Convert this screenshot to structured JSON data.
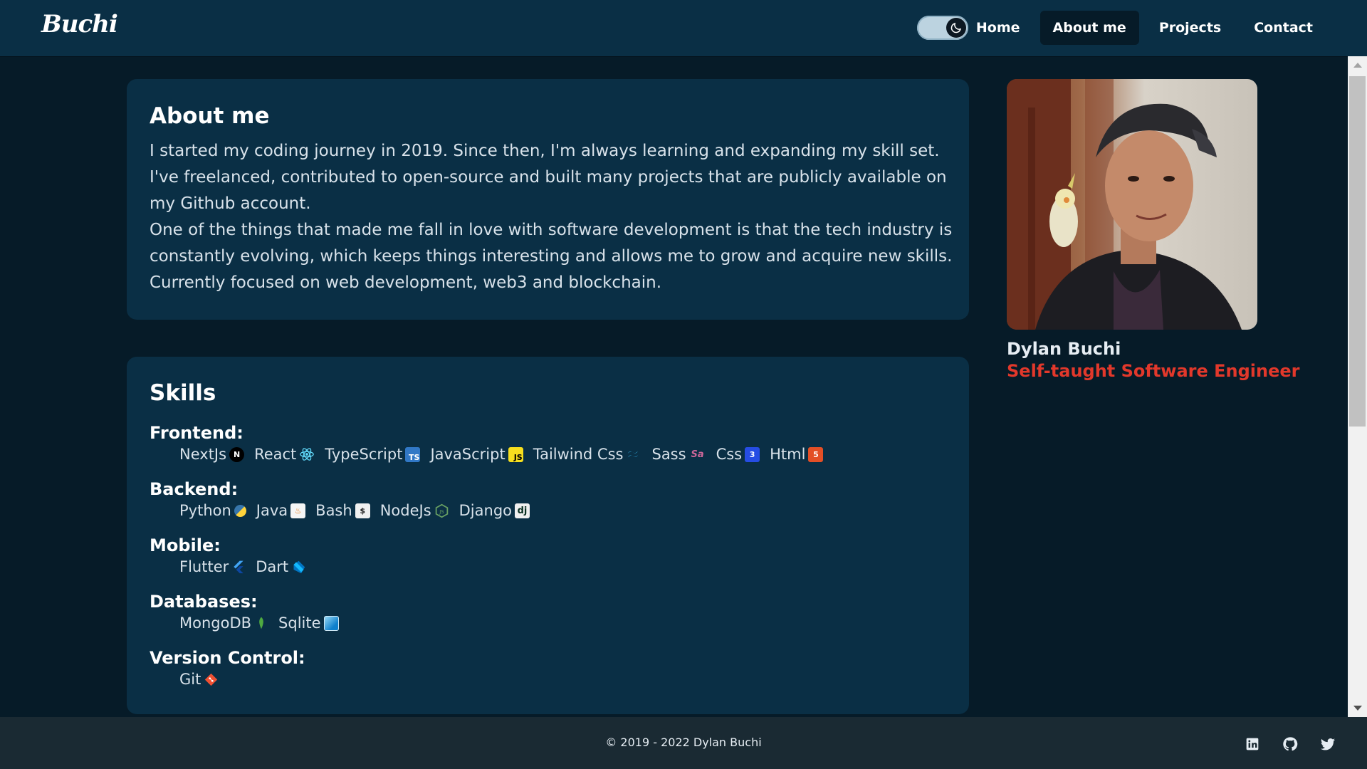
{
  "navbar": {
    "logo": "Buchi",
    "theme_toggle_icon": "moon-icon",
    "links": [
      {
        "label": "Home",
        "active": false
      },
      {
        "label": "About me",
        "active": true
      },
      {
        "label": "Projects",
        "active": false
      },
      {
        "label": "Contact",
        "active": false
      }
    ]
  },
  "about": {
    "title": "About me",
    "paragraph1": "I started my coding journey in 2019. Since then, I'm always learning and expanding my skill set. I've freelanced, contributed to open-source and built many projects that are publicly available on my Github account.",
    "paragraph2": "One of the things that made me fall in love with software development is that the tech industry is constantly evolving, which keeps things interesting and allows me to grow and acquire new skills. Currently focused on web development, web3 and blockchain."
  },
  "skills": {
    "title": "Skills",
    "groups": [
      {
        "category": "Frontend:",
        "items": [
          {
            "name": "NextJs",
            "icon": "nextjs-icon"
          },
          {
            "name": "React",
            "icon": "react-icon"
          },
          {
            "name": "TypeScript",
            "icon": "typescript-icon"
          },
          {
            "name": "JavaScript",
            "icon": "javascript-icon"
          },
          {
            "name": "Tailwind Css",
            "icon": "tailwind-icon"
          },
          {
            "name": "Sass",
            "icon": "sass-icon"
          },
          {
            "name": "Css",
            "icon": "css-icon"
          },
          {
            "name": "Html",
            "icon": "html-icon"
          }
        ]
      },
      {
        "category": "Backend:",
        "items": [
          {
            "name": "Python",
            "icon": "python-icon"
          },
          {
            "name": "Java",
            "icon": "java-icon"
          },
          {
            "name": "Bash",
            "icon": "bash-icon"
          },
          {
            "name": "NodeJs",
            "icon": "nodejs-icon"
          },
          {
            "name": "Django",
            "icon": "django-icon"
          }
        ]
      },
      {
        "category": "Mobile:",
        "items": [
          {
            "name": "Flutter",
            "icon": "flutter-icon"
          },
          {
            "name": "Dart",
            "icon": "dart-icon"
          }
        ]
      },
      {
        "category": "Databases:",
        "items": [
          {
            "name": "MongoDB",
            "icon": "mongodb-icon"
          },
          {
            "name": "Sqlite",
            "icon": "sqlite-icon"
          }
        ]
      },
      {
        "category": "Version Control:",
        "items": [
          {
            "name": "Git",
            "icon": "git-icon"
          }
        ]
      }
    ]
  },
  "profile": {
    "name": "Dylan Buchi",
    "title": "Self-taught Software Engineer",
    "photo": "profile-photo"
  },
  "footer": {
    "copyright": "© 2019 - 2022  Dylan Buchi",
    "social": [
      "linkedin-icon",
      "github-icon",
      "twitter-icon"
    ]
  },
  "colors": {
    "background": "#061b28",
    "card": "#0a2f45",
    "accent": "#e2382b",
    "footer": "#1a2a33"
  }
}
